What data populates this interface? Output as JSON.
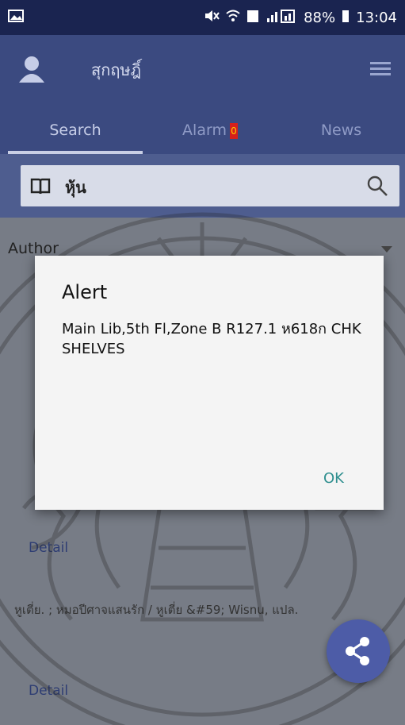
{
  "status_bar": {
    "battery": "88%",
    "time": "13:04"
  },
  "header": {
    "username": "สุกฤษฎิ์"
  },
  "tabs": [
    {
      "label": "Search"
    },
    {
      "label": "Alarm",
      "badge": "0"
    },
    {
      "label": "News"
    }
  ],
  "search": {
    "value": "หุ้น"
  },
  "filter": {
    "label": "Author"
  },
  "results": {
    "detail_label": "Detail",
    "record_text": "หูเตี่ย. ; หมอปีศาจแสนรัก / หูเตี่ย &#59; Wisnu, แปล."
  },
  "dialog": {
    "title": "Alert",
    "message": "Main Lib,5th Fl,Zone B R127.1 ห618ก CHK SHELVES",
    "ok_label": "OK"
  },
  "colors": {
    "header": "#3b4a80",
    "accent": "#2f8f8f",
    "badge": "#d6201c"
  }
}
